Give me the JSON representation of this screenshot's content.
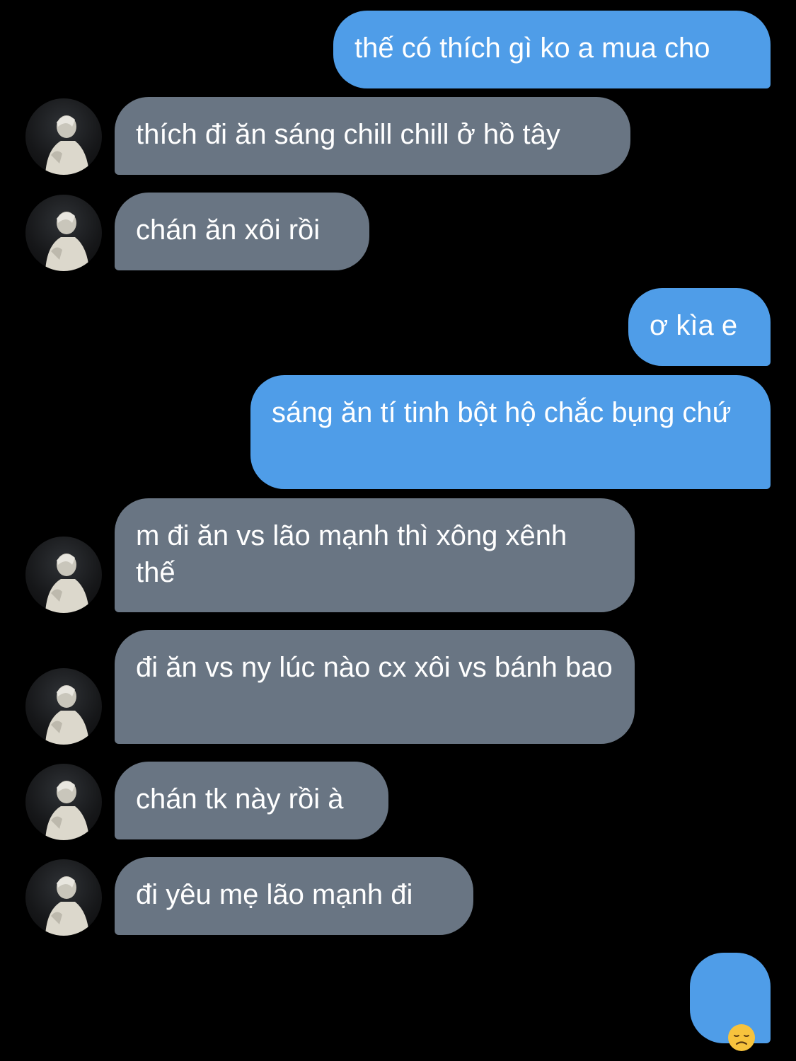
{
  "conversation": {
    "m1": "thế có thích gì ko a mua cho",
    "m2": "thích đi ăn sáng chill chill ở hồ tây",
    "m3": "chán ăn xôi rồi",
    "m4": "ơ kìa e",
    "m5": "sáng ăn tí tinh bột hộ chắc bụng chứ",
    "m6": "m đi ăn vs lão mạnh thì xông xênh thế",
    "m7": "đi ăn vs ny lúc nào cx xôi vs bánh bao",
    "m8": "chán tk này rồi à",
    "m9": "đi yêu mẹ lão mạnh đi",
    "m10_emoji": "disappointed-face-emoji"
  },
  "colors": {
    "background": "#000000",
    "outgoing_bubble": "#4f9de8",
    "incoming_bubble": "#697583",
    "text": "#ffffff"
  },
  "icons": {
    "avatar": "contact-avatar-photo"
  }
}
